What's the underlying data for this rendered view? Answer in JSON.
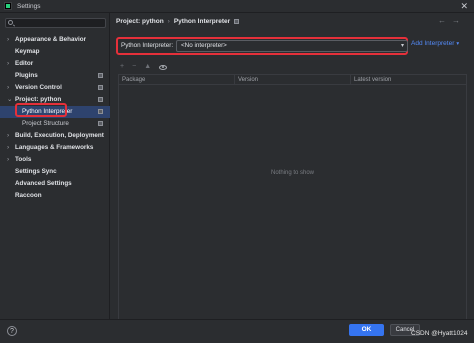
{
  "window": {
    "title": "Settings",
    "close_glyph": "✕"
  },
  "sidebar": {
    "items": [
      {
        "label": "Appearance & Behavior",
        "chevron": "›"
      },
      {
        "label": "Keymap",
        "chevron": ""
      },
      {
        "label": "Editor",
        "chevron": "›"
      },
      {
        "label": "Plugins",
        "chevron": ""
      },
      {
        "label": "Version Control",
        "chevron": "›"
      },
      {
        "label": "Project: python",
        "chevron": "⌄"
      },
      {
        "label": "Python Interpreter",
        "chevron": ""
      },
      {
        "label": "Project Structure",
        "chevron": ""
      },
      {
        "label": "Build, Execution, Deployment",
        "chevron": "›"
      },
      {
        "label": "Languages & Frameworks",
        "chevron": "›"
      },
      {
        "label": "Tools",
        "chevron": "›"
      },
      {
        "label": "Settings Sync",
        "chevron": ""
      },
      {
        "label": "Advanced Settings",
        "chevron": ""
      },
      {
        "label": "Raccoon",
        "chevron": ""
      }
    ]
  },
  "main": {
    "breadcrumb": {
      "parent": "Project: python",
      "separator": "›",
      "current": "Python Interpreter"
    },
    "nav": {
      "back": "←",
      "forward": "→"
    },
    "interpreter": {
      "label": "Python Interpreter:",
      "value": "<No interpreter>",
      "dropdown_glyph": "▾",
      "add_label": "Add Interpreter",
      "add_glyph": "▾"
    },
    "toolbar": {
      "add": "+",
      "remove": "−",
      "up": "▲",
      "show_early": "eye-icon"
    },
    "table": {
      "headers": [
        "Package",
        "Version",
        "Latest version"
      ],
      "empty_text": "Nothing to show"
    }
  },
  "footer": {
    "help": "?",
    "ok_label": "OK",
    "cancel_label": "Cancel",
    "watermark": "CSDN @Hyatt1024"
  },
  "colors": {
    "background": "#2b2d30",
    "selection": "#2e436e",
    "highlight_red": "#e5303a",
    "link_blue": "#548af7",
    "primary_button": "#3574f0"
  }
}
